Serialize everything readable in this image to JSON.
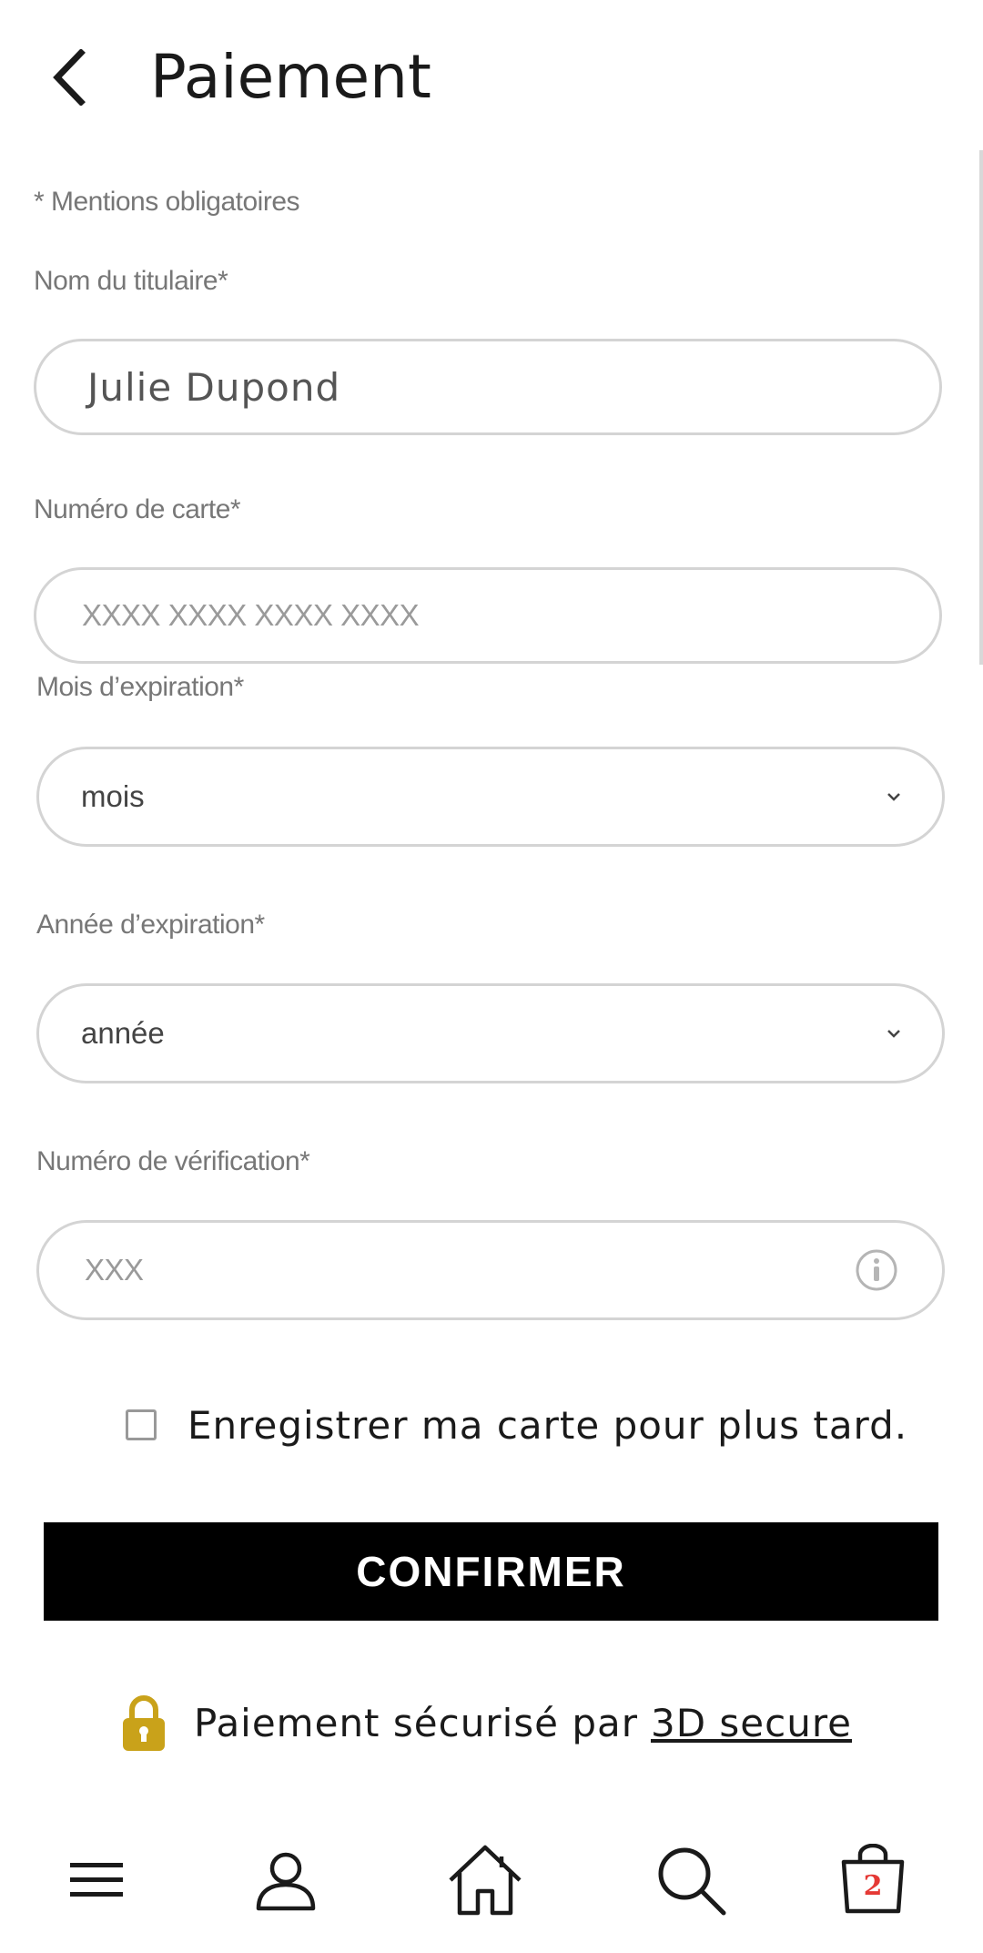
{
  "header": {
    "title": "Paiement",
    "back_icon": "chevron-left-icon"
  },
  "form": {
    "mandatory_note": "* Mentions obligatoires",
    "holder": {
      "label": "Nom du titulaire*",
      "value": "Julie Dupond"
    },
    "card_number": {
      "label": "Numéro de carte*",
      "placeholder": "XXXX XXXX XXXX XXXX"
    },
    "exp_month": {
      "label": "Mois d’expiration*",
      "selected": "mois"
    },
    "exp_year": {
      "label": "Année d’expiration*",
      "selected": "année"
    },
    "cvv": {
      "label": "Numéro de vérification*",
      "placeholder": "XXX",
      "icon": "info-icon"
    },
    "save_card": {
      "label": "Enregistrer ma carte pour plus tard.",
      "checked": false
    },
    "confirm_label": "CONFIRMER"
  },
  "secure": {
    "text": "Paiement sécurisé par",
    "link": "3D secure",
    "icon": "lock-icon",
    "lock_color": "#C9A21A"
  },
  "bottom_nav": {
    "items": [
      {
        "icon": "menu-icon"
      },
      {
        "icon": "account-icon"
      },
      {
        "icon": "home-icon"
      },
      {
        "icon": "search-icon"
      },
      {
        "icon": "cart-icon",
        "badge": "2"
      }
    ],
    "badge_color": "#E53935"
  }
}
